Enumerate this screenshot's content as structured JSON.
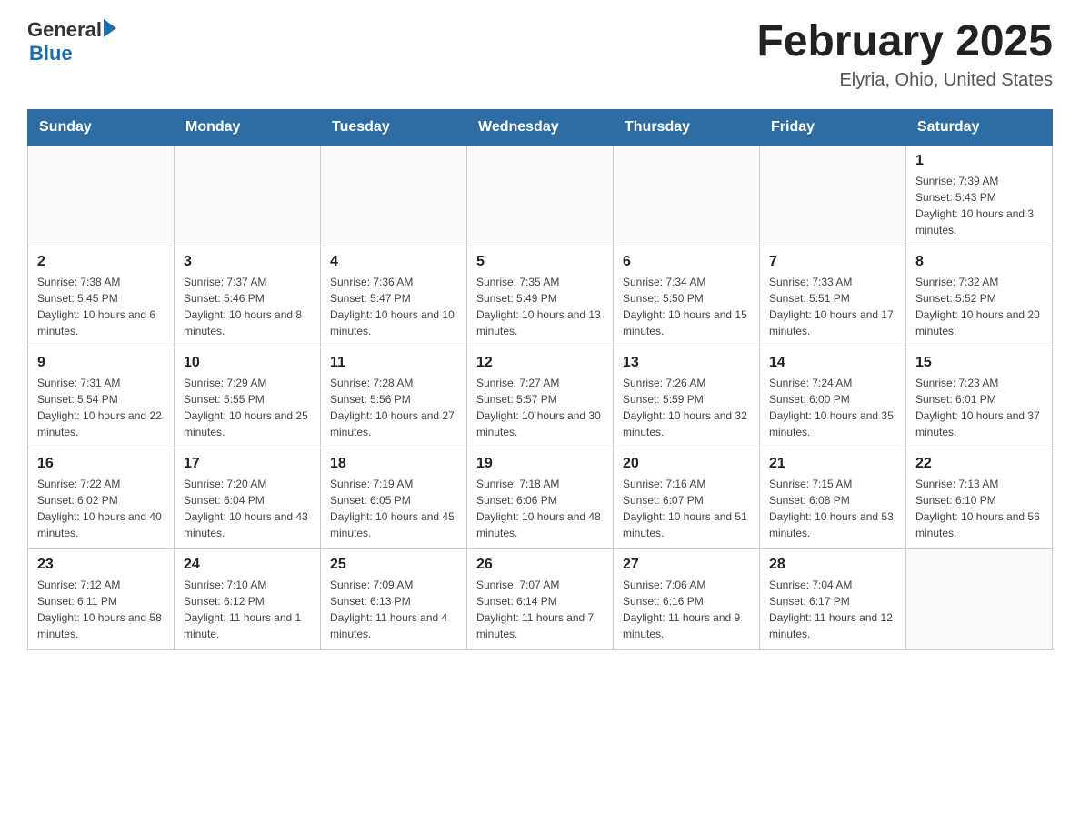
{
  "header": {
    "logo": {
      "general": "General",
      "arrow": "▶",
      "blue": "Blue"
    },
    "title": "February 2025",
    "subtitle": "Elyria, Ohio, United States"
  },
  "weekdays": [
    "Sunday",
    "Monday",
    "Tuesday",
    "Wednesday",
    "Thursday",
    "Friday",
    "Saturday"
  ],
  "weeks": [
    [
      {
        "day": "",
        "sunrise": "",
        "sunset": "",
        "daylight": ""
      },
      {
        "day": "",
        "sunrise": "",
        "sunset": "",
        "daylight": ""
      },
      {
        "day": "",
        "sunrise": "",
        "sunset": "",
        "daylight": ""
      },
      {
        "day": "",
        "sunrise": "",
        "sunset": "",
        "daylight": ""
      },
      {
        "day": "",
        "sunrise": "",
        "sunset": "",
        "daylight": ""
      },
      {
        "day": "",
        "sunrise": "",
        "sunset": "",
        "daylight": ""
      },
      {
        "day": "1",
        "sunrise": "Sunrise: 7:39 AM",
        "sunset": "Sunset: 5:43 PM",
        "daylight": "Daylight: 10 hours and 3 minutes."
      }
    ],
    [
      {
        "day": "2",
        "sunrise": "Sunrise: 7:38 AM",
        "sunset": "Sunset: 5:45 PM",
        "daylight": "Daylight: 10 hours and 6 minutes."
      },
      {
        "day": "3",
        "sunrise": "Sunrise: 7:37 AM",
        "sunset": "Sunset: 5:46 PM",
        "daylight": "Daylight: 10 hours and 8 minutes."
      },
      {
        "day": "4",
        "sunrise": "Sunrise: 7:36 AM",
        "sunset": "Sunset: 5:47 PM",
        "daylight": "Daylight: 10 hours and 10 minutes."
      },
      {
        "day": "5",
        "sunrise": "Sunrise: 7:35 AM",
        "sunset": "Sunset: 5:49 PM",
        "daylight": "Daylight: 10 hours and 13 minutes."
      },
      {
        "day": "6",
        "sunrise": "Sunrise: 7:34 AM",
        "sunset": "Sunset: 5:50 PM",
        "daylight": "Daylight: 10 hours and 15 minutes."
      },
      {
        "day": "7",
        "sunrise": "Sunrise: 7:33 AM",
        "sunset": "Sunset: 5:51 PM",
        "daylight": "Daylight: 10 hours and 17 minutes."
      },
      {
        "day": "8",
        "sunrise": "Sunrise: 7:32 AM",
        "sunset": "Sunset: 5:52 PM",
        "daylight": "Daylight: 10 hours and 20 minutes."
      }
    ],
    [
      {
        "day": "9",
        "sunrise": "Sunrise: 7:31 AM",
        "sunset": "Sunset: 5:54 PM",
        "daylight": "Daylight: 10 hours and 22 minutes."
      },
      {
        "day": "10",
        "sunrise": "Sunrise: 7:29 AM",
        "sunset": "Sunset: 5:55 PM",
        "daylight": "Daylight: 10 hours and 25 minutes."
      },
      {
        "day": "11",
        "sunrise": "Sunrise: 7:28 AM",
        "sunset": "Sunset: 5:56 PM",
        "daylight": "Daylight: 10 hours and 27 minutes."
      },
      {
        "day": "12",
        "sunrise": "Sunrise: 7:27 AM",
        "sunset": "Sunset: 5:57 PM",
        "daylight": "Daylight: 10 hours and 30 minutes."
      },
      {
        "day": "13",
        "sunrise": "Sunrise: 7:26 AM",
        "sunset": "Sunset: 5:59 PM",
        "daylight": "Daylight: 10 hours and 32 minutes."
      },
      {
        "day": "14",
        "sunrise": "Sunrise: 7:24 AM",
        "sunset": "Sunset: 6:00 PM",
        "daylight": "Daylight: 10 hours and 35 minutes."
      },
      {
        "day": "15",
        "sunrise": "Sunrise: 7:23 AM",
        "sunset": "Sunset: 6:01 PM",
        "daylight": "Daylight: 10 hours and 37 minutes."
      }
    ],
    [
      {
        "day": "16",
        "sunrise": "Sunrise: 7:22 AM",
        "sunset": "Sunset: 6:02 PM",
        "daylight": "Daylight: 10 hours and 40 minutes."
      },
      {
        "day": "17",
        "sunrise": "Sunrise: 7:20 AM",
        "sunset": "Sunset: 6:04 PM",
        "daylight": "Daylight: 10 hours and 43 minutes."
      },
      {
        "day": "18",
        "sunrise": "Sunrise: 7:19 AM",
        "sunset": "Sunset: 6:05 PM",
        "daylight": "Daylight: 10 hours and 45 minutes."
      },
      {
        "day": "19",
        "sunrise": "Sunrise: 7:18 AM",
        "sunset": "Sunset: 6:06 PM",
        "daylight": "Daylight: 10 hours and 48 minutes."
      },
      {
        "day": "20",
        "sunrise": "Sunrise: 7:16 AM",
        "sunset": "Sunset: 6:07 PM",
        "daylight": "Daylight: 10 hours and 51 minutes."
      },
      {
        "day": "21",
        "sunrise": "Sunrise: 7:15 AM",
        "sunset": "Sunset: 6:08 PM",
        "daylight": "Daylight: 10 hours and 53 minutes."
      },
      {
        "day": "22",
        "sunrise": "Sunrise: 7:13 AM",
        "sunset": "Sunset: 6:10 PM",
        "daylight": "Daylight: 10 hours and 56 minutes."
      }
    ],
    [
      {
        "day": "23",
        "sunrise": "Sunrise: 7:12 AM",
        "sunset": "Sunset: 6:11 PM",
        "daylight": "Daylight: 10 hours and 58 minutes."
      },
      {
        "day": "24",
        "sunrise": "Sunrise: 7:10 AM",
        "sunset": "Sunset: 6:12 PM",
        "daylight": "Daylight: 11 hours and 1 minute."
      },
      {
        "day": "25",
        "sunrise": "Sunrise: 7:09 AM",
        "sunset": "Sunset: 6:13 PM",
        "daylight": "Daylight: 11 hours and 4 minutes."
      },
      {
        "day": "26",
        "sunrise": "Sunrise: 7:07 AM",
        "sunset": "Sunset: 6:14 PM",
        "daylight": "Daylight: 11 hours and 7 minutes."
      },
      {
        "day": "27",
        "sunrise": "Sunrise: 7:06 AM",
        "sunset": "Sunset: 6:16 PM",
        "daylight": "Daylight: 11 hours and 9 minutes."
      },
      {
        "day": "28",
        "sunrise": "Sunrise: 7:04 AM",
        "sunset": "Sunset: 6:17 PM",
        "daylight": "Daylight: 11 hours and 12 minutes."
      },
      {
        "day": "",
        "sunrise": "",
        "sunset": "",
        "daylight": ""
      }
    ]
  ]
}
